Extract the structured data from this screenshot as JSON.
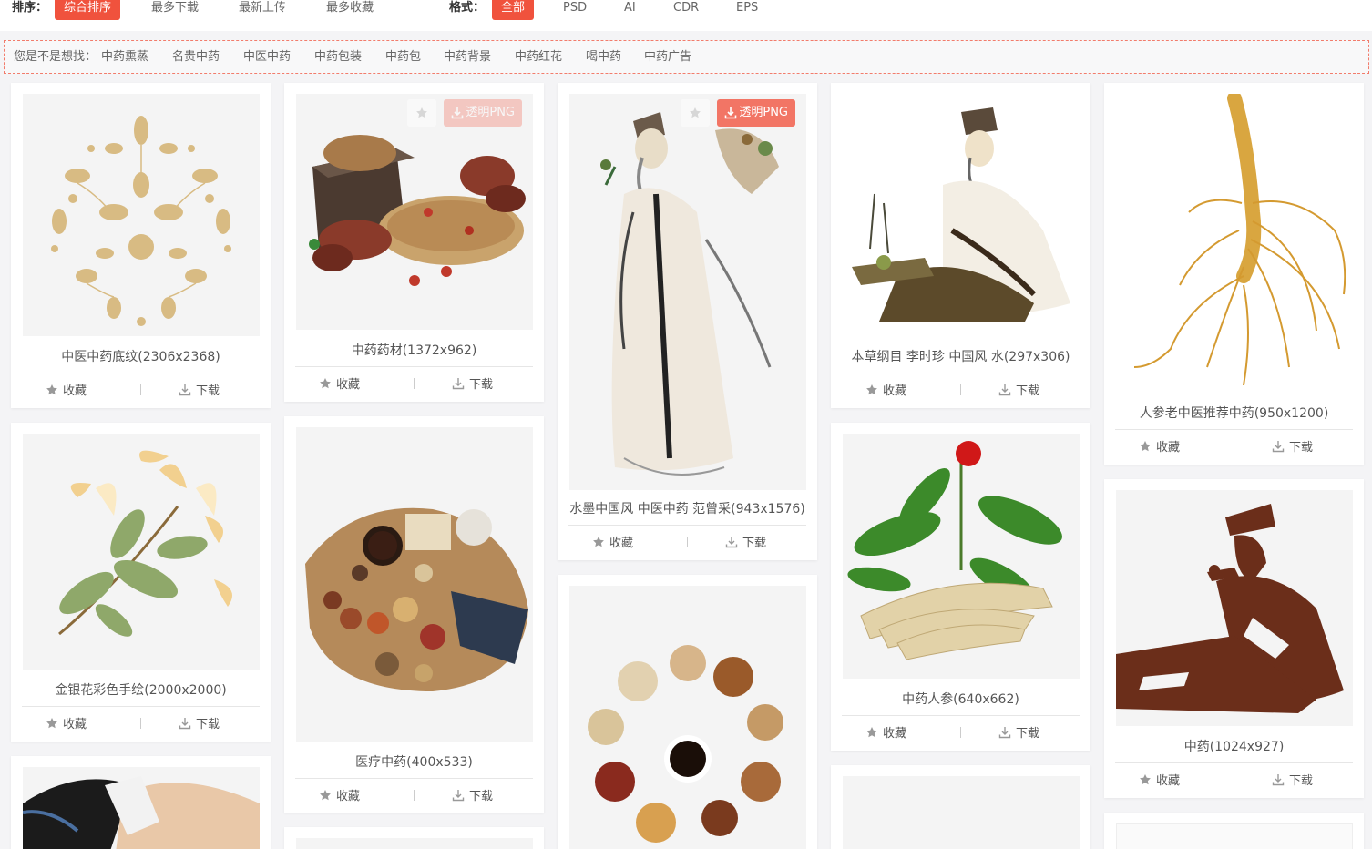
{
  "filters": {
    "sort_label": "排序：",
    "sort_options": [
      "综合排序",
      "最多下载",
      "最新上传",
      "最多收藏"
    ],
    "format_label": "格式：",
    "format_options": [
      "全部",
      "PSD",
      "AI",
      "CDR",
      "EPS"
    ]
  },
  "suggestions": {
    "prefix": "您是不是想找：",
    "items": [
      "中药熏蒸",
      "名贵中药",
      "中医中药",
      "中药包装",
      "中药包",
      "中药背景",
      "中药红花",
      "喝中药",
      "中药广告"
    ]
  },
  "actions": {
    "favorite": "收藏",
    "download": "下载",
    "png_badge": "透明PNG"
  },
  "cards": [
    {
      "title": "中医中药底纹(2306x2368)",
      "art": "gold-herb-pattern"
    },
    {
      "title": "中药药材(1372x962)",
      "art": "herb-box-lingzhi"
    },
    {
      "title": "水墨中国风 中医中药 范曾采(943x1576)",
      "art": "ink-herbalist-standing"
    },
    {
      "title": "本草纲目 李时珍 中国风 水(297x306)",
      "art": "ink-li-shizhen"
    },
    {
      "title": "人参老中医推荐中药(950x1200)",
      "art": "ginseng-root"
    },
    {
      "title": "金银花彩色手绘(2000x2000)",
      "art": "honeysuckle-flower"
    },
    {
      "title": "医疗中药(400x533)",
      "art": "herb-table-topview"
    },
    {
      "title": "中药人参(640x662)",
      "art": "ginseng-plant-bundle"
    },
    {
      "title": "中药(1024x927)",
      "art": "brown-silhouette-sage"
    },
    {
      "title": "",
      "art": "hand-ink-brush"
    },
    {
      "title": "",
      "art": "herb-ring-bowl"
    },
    {
      "title": "",
      "art": "blank"
    },
    {
      "title": "",
      "art": "blank"
    },
    {
      "title": "",
      "art": "blank"
    }
  ],
  "colors": {
    "accent": "#f0523d",
    "badge": "#f27565",
    "gold": "#d8bb83",
    "brown": "#6b2e1a"
  }
}
